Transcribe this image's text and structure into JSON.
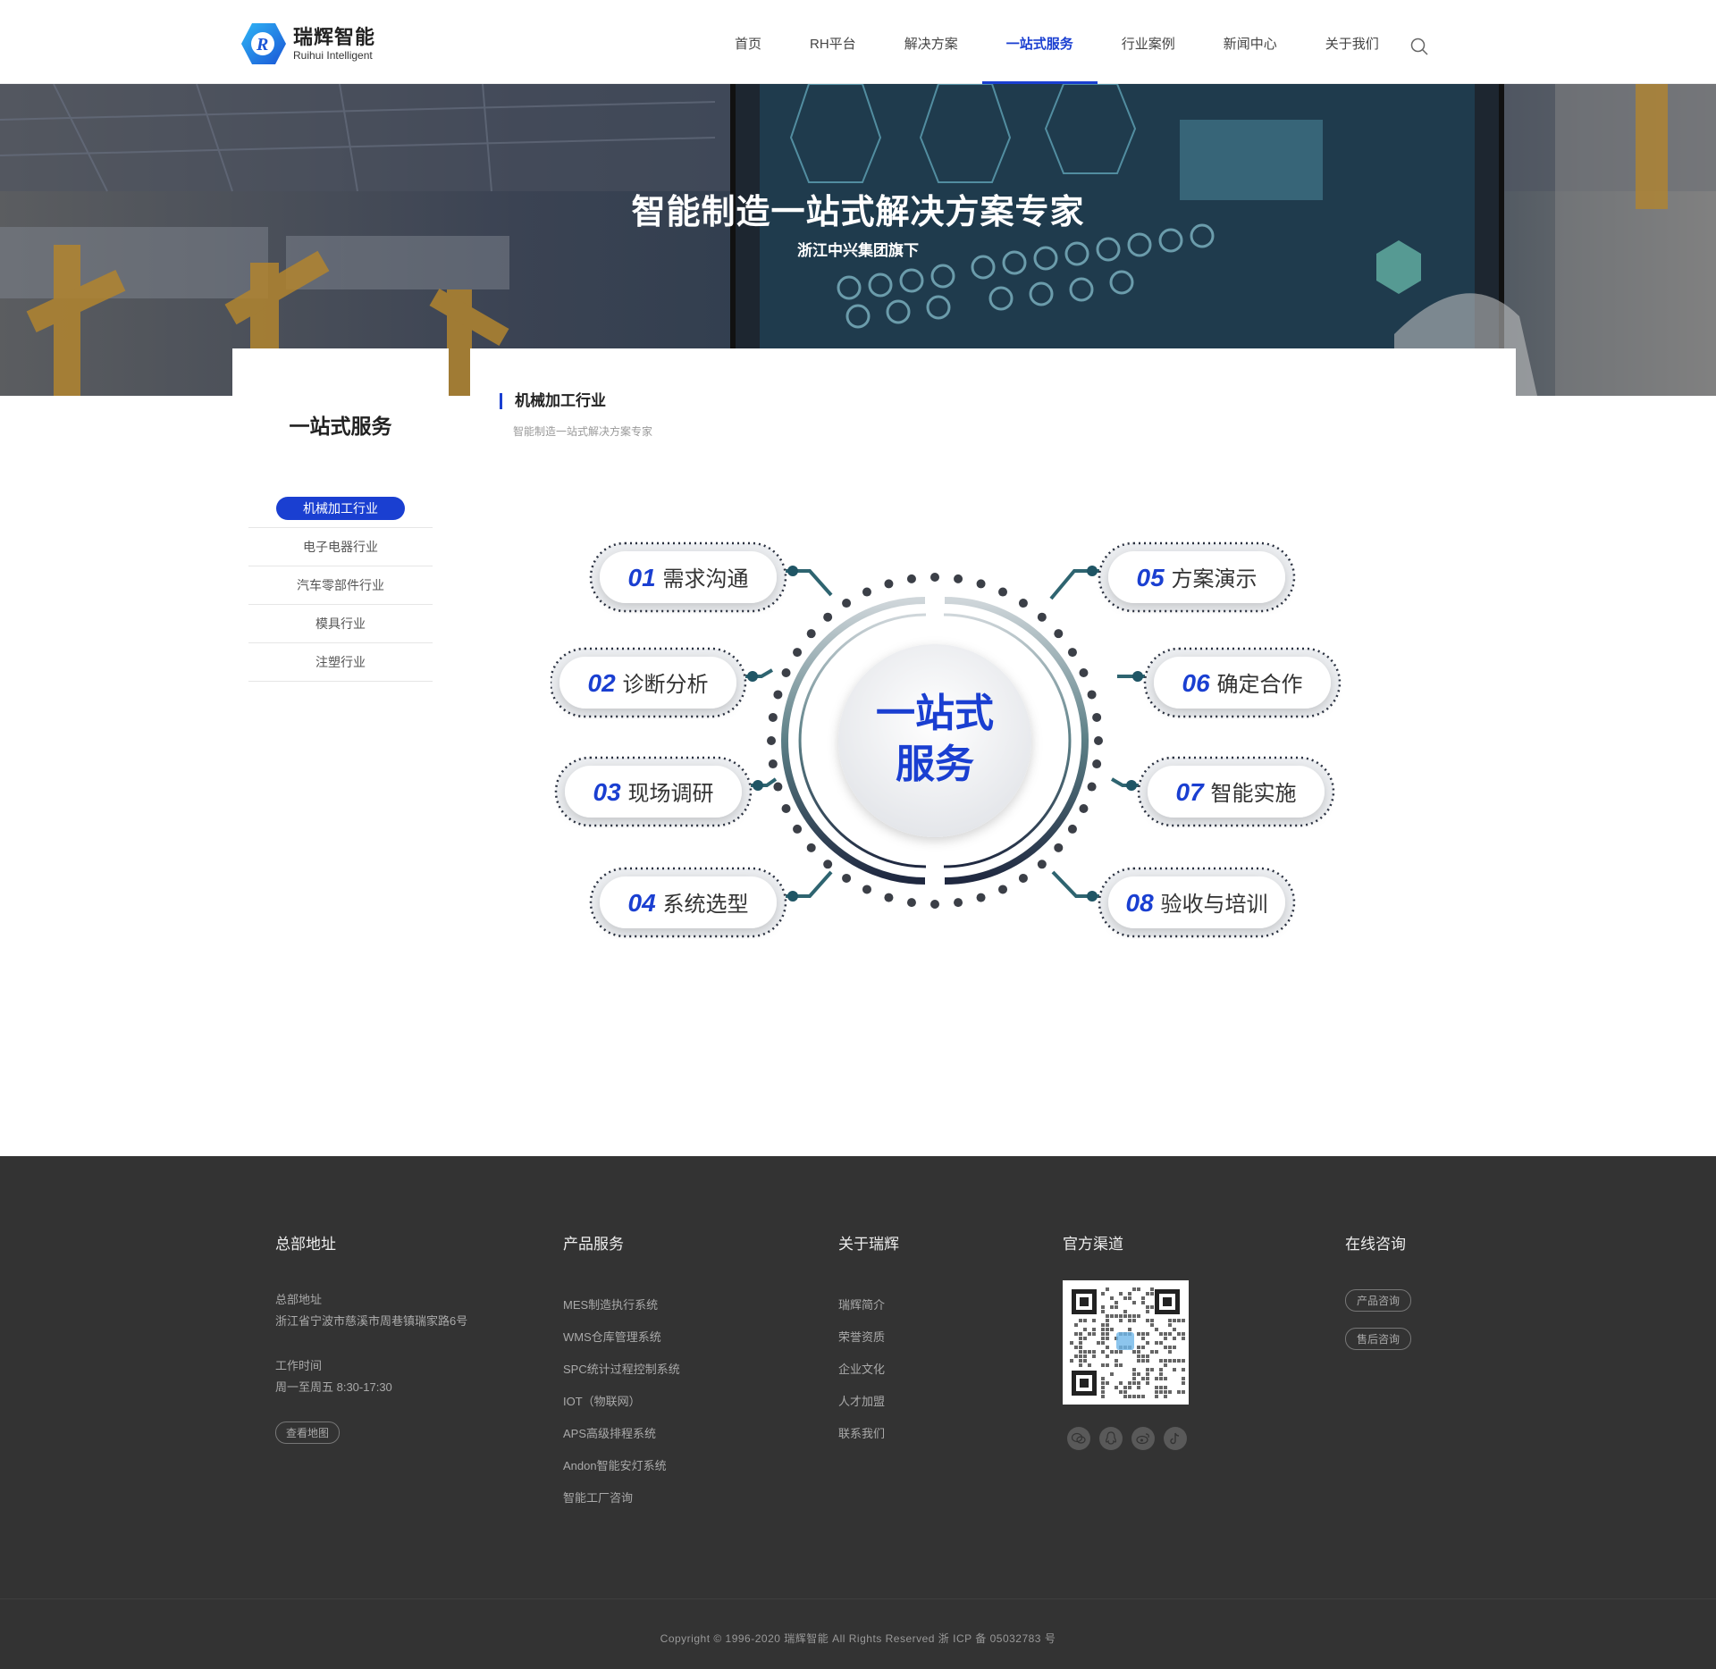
{
  "brand": {
    "name_cn": "瑞辉智能",
    "name_en": "Ruihui Intelligent"
  },
  "nav": {
    "items": [
      "首页",
      "RH平台",
      "解决方案",
      "一站式服务",
      "行业案例",
      "新闻中心",
      "关于我们"
    ],
    "active": "一站式服务"
  },
  "banner": {
    "title": "智能制造一站式解决方案专家",
    "subtitle": "浙江中兴集团旗下"
  },
  "sidebar": {
    "title": "一站式服务",
    "items": [
      "机械加工行业",
      "电子电器行业",
      "汽车零部件行业",
      "模具行业",
      "注塑行业"
    ],
    "active": "机械加工行业"
  },
  "section": {
    "title": "机械加工行业",
    "subtitle": "智能制造一站式解决方案专家"
  },
  "diagram": {
    "center_line1": "一站式",
    "center_line2": "服务",
    "steps": [
      {
        "num": "01",
        "label": "需求沟通"
      },
      {
        "num": "02",
        "label": "诊断分析"
      },
      {
        "num": "03",
        "label": "现场调研"
      },
      {
        "num": "04",
        "label": "系统选型"
      },
      {
        "num": "05",
        "label": "方案演示"
      },
      {
        "num": "06",
        "label": "确定合作"
      },
      {
        "num": "07",
        "label": "智能实施"
      },
      {
        "num": "08",
        "label": "验收与培训"
      }
    ]
  },
  "footer": {
    "address": {
      "heading": "总部地址",
      "addr_label": "总部地址",
      "addr_value": "浙江省宁波市慈溪市周巷镇瑞家路6号",
      "hours_label": "工作时间",
      "hours_value": "周一至周五 8:30-17:30",
      "map_button": "查看地图"
    },
    "products": {
      "heading": "产品服务",
      "links": [
        "MES制造执行系统",
        "WMS仓库管理系统",
        "SPC统计过程控制系统",
        "IOT（物联网）",
        "APS高级排程系统",
        "Andon智能安灯系统",
        "智能工厂咨询"
      ]
    },
    "about": {
      "heading": "关于瑞辉",
      "links": [
        "瑞辉简介",
        "荣誉资质",
        "企业文化",
        "人才加盟",
        "联系我们"
      ]
    },
    "channels": {
      "heading": "官方渠道",
      "social_icons": [
        "wechat-icon",
        "qq-icon",
        "weibo-icon",
        "douyin-icon"
      ]
    },
    "consult": {
      "heading": "在线咨询",
      "buttons": [
        "产品咨询",
        "售后咨询"
      ]
    },
    "copyright": "Copyright © 1996-2020 瑞辉智能 All Rights Reserved    浙 ICP 备 05032783 号"
  },
  "colors": {
    "accent": "#1a3fd1",
    "footer_bg": "#333333",
    "teal": "#2e6470"
  }
}
